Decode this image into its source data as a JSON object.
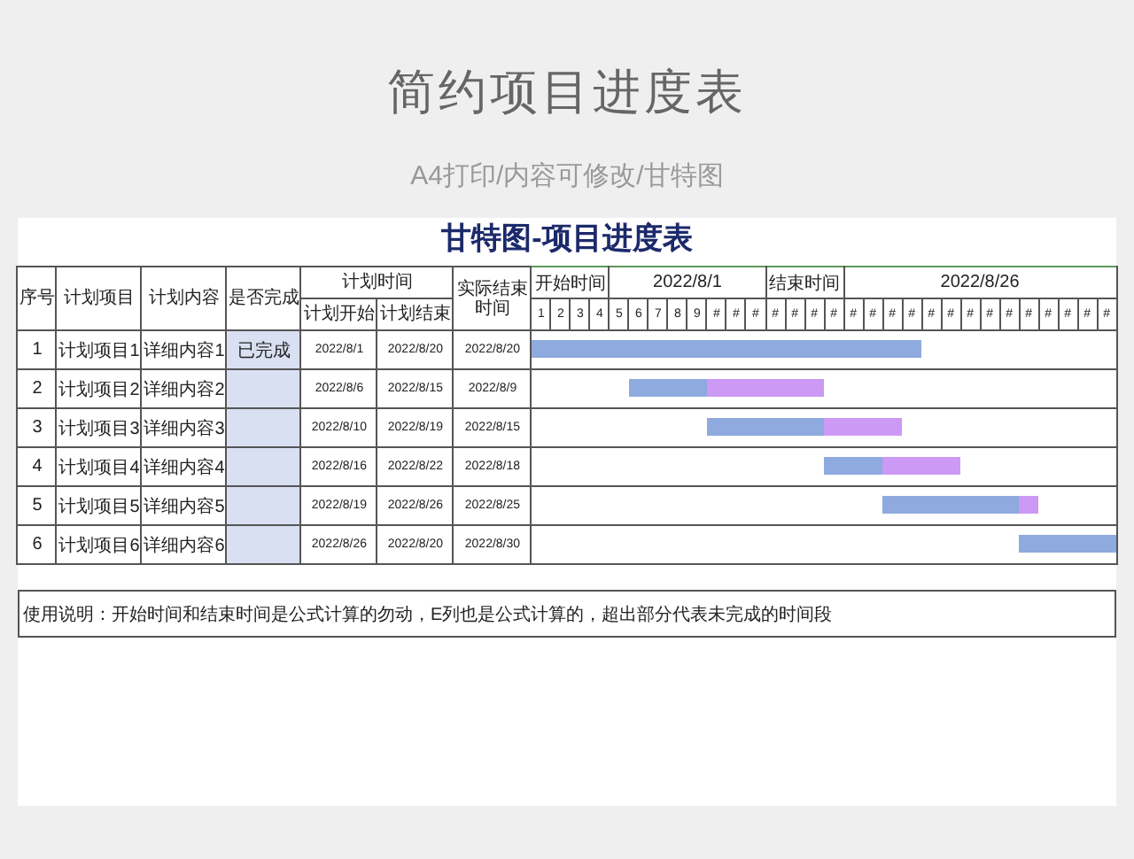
{
  "title": "简约项目进度表",
  "subtitle": "A4打印/内容可修改/甘特图",
  "sheet_title": "甘特图-项目进度表",
  "columns": {
    "no": "序号",
    "item": "计划项目",
    "detail": "计划内容",
    "status": "是否完成",
    "plan_time": "计划时间",
    "plan_start": "计划开始",
    "plan_end": "计划结束",
    "actual_end": "实际结束时间"
  },
  "gantt_header": {
    "start_label": "开始时间",
    "start_date": "2022/8/1",
    "end_label": "结束时间",
    "end_date": "2022/8/26"
  },
  "days": [
    "1",
    "2",
    "3",
    "4",
    "5",
    "6",
    "7",
    "8",
    "9",
    "#",
    "#",
    "#",
    "#",
    "#",
    "#",
    "#",
    "#",
    "#",
    "#",
    "#",
    "#",
    "#",
    "#",
    "#",
    "#",
    "#",
    "#",
    "#",
    "#",
    "#"
  ],
  "rows": [
    {
      "no": "1",
      "item": "计划项目1",
      "detail": "详细内容1",
      "status": "已完成",
      "plan_start": "2022/8/1",
      "plan_end": "2022/8/20",
      "actual_end": "2022/8/20"
    },
    {
      "no": "2",
      "item": "计划项目2",
      "detail": "详细内容2",
      "plan_start": "2022/8/6",
      "plan_end": "2022/8/15",
      "actual_end": "2022/8/9"
    },
    {
      "no": "3",
      "item": "计划项目3",
      "detail": "详细内容3",
      "plan_start": "2022/8/10",
      "plan_end": "2022/8/19",
      "actual_end": "2022/8/15"
    },
    {
      "no": "4",
      "item": "计划项目4",
      "detail": "详细内容4",
      "plan_start": "2022/8/16",
      "plan_end": "2022/8/22",
      "actual_end": "2022/8/18"
    },
    {
      "no": "5",
      "item": "计划项目5",
      "detail": "详细内容5",
      "plan_start": "2022/8/19",
      "plan_end": "2022/8/26",
      "actual_end": "2022/8/25"
    },
    {
      "no": "6",
      "item": "计划项目6",
      "detail": "详细内容6",
      "plan_start": "2022/8/26",
      "plan_end": "2022/8/20",
      "actual_end": "2022/8/30"
    }
  ],
  "note": "使用说明：开始时间和结束时间是公式计算的勿动，E列也是公式计算的，超出部分代表未完成的时间段"
}
